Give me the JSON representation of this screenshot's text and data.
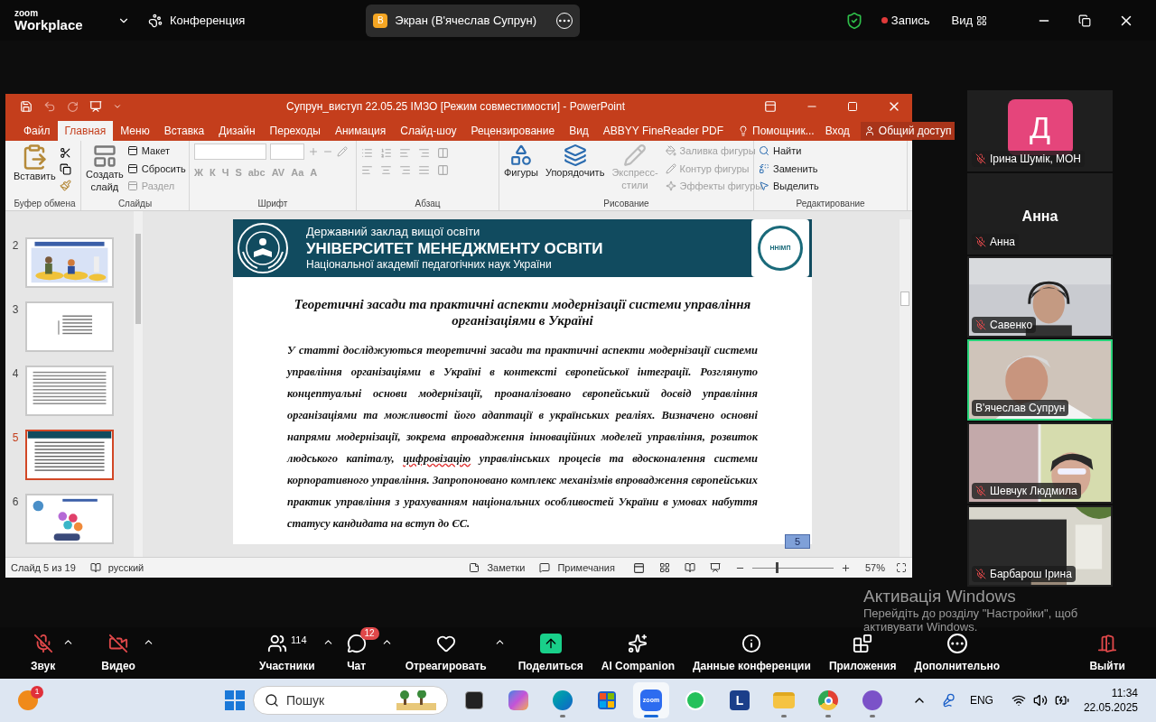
{
  "zoom_bar": {
    "brand_top": "zoom",
    "brand_bottom": "Workplace",
    "meeting": "Конференция",
    "share": {
      "badge": "В",
      "title": "Экран (В'ячеслав Супрун)"
    },
    "record": "Запись",
    "view": "Вид"
  },
  "powerpoint": {
    "title": "Супрун_виступ 22.05.25 ІМЗО [Режим совместимости] - PowerPoint",
    "tabs": [
      {
        "label": "Файл",
        "selected": false
      },
      {
        "label": "Главная",
        "selected": true
      },
      {
        "label": "Меню",
        "selected": false
      },
      {
        "label": "Вставка",
        "selected": false
      },
      {
        "label": "Дизайн",
        "selected": false
      },
      {
        "label": "Переходы",
        "selected": false
      },
      {
        "label": "Анимация",
        "selected": false
      },
      {
        "label": "Слайд-шоу",
        "selected": false
      },
      {
        "label": "Рецензирование",
        "selected": false
      },
      {
        "label": "Вид",
        "selected": false
      },
      {
        "label": "ABBYY FineReader PDF",
        "selected": false
      }
    ],
    "assistant": "Помощник...",
    "sign_in": "Вход",
    "share": "Общий доступ",
    "ribbon": [
      {
        "kind": "clipboard",
        "label": "Буфер обмена",
        "big": [
          {
            "lines": [
              "Вставить"
            ],
            "disabled": false
          }
        ]
      },
      {
        "kind": "slides",
        "label": "Слайды",
        "big": [
          {
            "lines": [
              "Создать",
              "слайд"
            ],
            "disabled": false
          }
        ],
        "items": [
          {
            "label": "Макет",
            "disabled": false
          },
          {
            "label": "Сбросить",
            "disabled": false
          },
          {
            "label": "Раздел",
            "disabled": true
          }
        ]
      },
      {
        "kind": "font",
        "label": "Шрифт",
        "items": [
          {
            "label": "Ж",
            "disabled": true
          },
          {
            "label": "К",
            "disabled": true
          },
          {
            "label": "Ч",
            "disabled": true
          },
          {
            "label": "S",
            "disabled": true
          },
          {
            "label": "abc",
            "disabled": true
          },
          {
            "label": "AV",
            "disabled": true
          },
          {
            "label": "Aa",
            "disabled": true
          },
          {
            "label": "A",
            "disabled": true
          }
        ]
      },
      {
        "kind": "paragraph",
        "label": "Абзац"
      },
      {
        "kind": "drawing",
        "label": "Рисование",
        "big": [
          {
            "lines": [
              "Фигуры"
            ],
            "disabled": false
          },
          {
            "lines": [
              "Упорядочить"
            ],
            "disabled": false
          },
          {
            "lines": [
              "Экспресс-",
              "стили"
            ],
            "disabled": true
          }
        ],
        "items": [
          {
            "label": "Заливка фигуры",
            "disabled": true
          },
          {
            "label": "Контур фигуры",
            "disabled": true
          },
          {
            "label": "Эффекты фигуры",
            "disabled": true
          }
        ]
      },
      {
        "kind": "editing",
        "label": "Редактирование",
        "items": [
          {
            "label": "Найти",
            "disabled": false
          },
          {
            "label": "Заменить",
            "disabled": false
          },
          {
            "label": "Выделить",
            "disabled": false
          }
        ]
      }
    ],
    "thumbnails": [
      {
        "number": "2",
        "selected": false
      },
      {
        "number": "3",
        "selected": false
      },
      {
        "number": "4",
        "selected": false
      },
      {
        "number": "5",
        "selected": true
      },
      {
        "number": "6",
        "selected": false
      }
    ],
    "slide": {
      "header_line1": "Державний заклад вищої освіти",
      "header_line2": "УНІВЕРСИТЕТ МЕНЕДЖМЕНТУ ОСВІТИ",
      "header_line3": "Національної академії педагогічних наук України",
      "logo_text": "ННІМП",
      "title": "Теоретичні засади та практичні аспекти модернізації системи управління організаціями в Україні",
      "body_before": "У статті досліджуються теоретичні засади та практичні аспекти модернізації системи управління організаціями в Україні в контексті європейської інтеграції. Розглянуто концептуальні основи модернізації, проаналізовано європейський досвід управління організаціями та можливості його адаптації в українських реаліях. Визначено основні напрями модернізації, зокрема впровадження інноваційних моделей управління, розвиток людського капіталу, ",
      "body_flagged": "цифровізацію",
      "body_after": " управлінських процесів та вдосконалення системи корпоративного управління. Запропоновано комплекс механізмів впровадження європейських практик управління з урахуванням національних особливостей України в умовах набуття статусу кандидата на вступ до ЄС.",
      "page": "5"
    },
    "status": {
      "slide": "Слайд 5 из 19",
      "language": "русский",
      "notes": "Заметки",
      "comments": "Примечания",
      "zoom_slider": {
        "level": 0.3
      },
      "zoom": "57%"
    }
  },
  "participants": [
    {
      "kind": "avatar",
      "letter": "Д",
      "color": "#e5457b",
      "name": "Ірина Шумік, МОН",
      "muted": true,
      "speaking": false
    },
    {
      "kind": "name",
      "display": "Анна",
      "name": "Анна",
      "muted": true,
      "speaking": false
    },
    {
      "kind": "video",
      "name": "Савенко",
      "muted": true,
      "speaking": false
    },
    {
      "kind": "video",
      "name": "В'ячеслав Супрун",
      "muted": false,
      "speaking": true
    },
    {
      "kind": "video",
      "name": "Шевчук Людмила",
      "muted": true,
      "speaking": false
    },
    {
      "kind": "video",
      "name": "Барбарош Ірина",
      "muted": true,
      "speaking": false
    }
  ],
  "activation": {
    "title": "Активація Windows",
    "line1": "Перейдіть до розділу \"Настройки\", щоб",
    "line2": "активувати Windows."
  },
  "toolbar": [
    {
      "kind": "audio",
      "label": "Звук",
      "off": true,
      "caret": true
    },
    {
      "kind": "video",
      "label": "Видео",
      "off": true,
      "caret": true
    },
    {
      "kind": "participants",
      "label": "Участники",
      "count": "114",
      "caret": true
    },
    {
      "kind": "chat",
      "label": "Чат",
      "badge": "12",
      "caret": true
    },
    {
      "kind": "react",
      "label": "Отреагировать",
      "caret": true
    },
    {
      "kind": "share",
      "label": "Поделиться",
      "caret": false
    },
    {
      "kind": "ai",
      "label": "AI Companion",
      "caret": false
    },
    {
      "kind": "info",
      "label": "Данные конференции",
      "caret": false
    },
    {
      "kind": "apps",
      "label": "Приложения",
      "caret": false
    },
    {
      "kind": "more",
      "label": "Дополнительно",
      "caret": false
    },
    {
      "kind": "leave",
      "label": "Выйти",
      "caret": false
    }
  ],
  "taskbar": {
    "notifications": "1",
    "search_placeholder": "Пошук",
    "apps": [
      {
        "kind": "terminal",
        "running": false,
        "selected": false
      },
      {
        "kind": "copilot",
        "running": false,
        "selected": false
      },
      {
        "kind": "edge",
        "running": true,
        "selected": false
      },
      {
        "kind": "store",
        "running": false,
        "selected": false
      },
      {
        "kind": "zoom",
        "label": "zoom",
        "running": true,
        "selected": true
      },
      {
        "kind": "whatsapp",
        "running": false,
        "selected": false
      },
      {
        "kind": "letter",
        "label": "L",
        "running": false,
        "selected": false
      },
      {
        "kind": "folder",
        "running": true,
        "selected": false
      },
      {
        "kind": "chrome",
        "running": true,
        "selected": false
      },
      {
        "kind": "viber",
        "running": true,
        "selected": false
      }
    ],
    "language": "ENG",
    "time": "11:34",
    "date": "22.05.2025"
  }
}
